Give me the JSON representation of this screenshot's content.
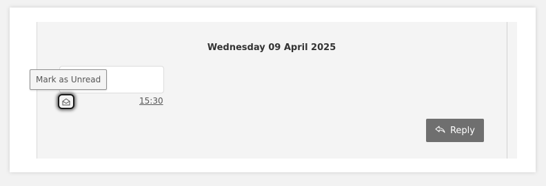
{
  "thread": {
    "date_heading": "Wednesday 09 April 2025",
    "message": {
      "timestamp": "15:30",
      "body": ""
    }
  },
  "tooltip": {
    "text": "Mark as Unread"
  },
  "icons": {
    "mark_unread": "envelope-open-icon",
    "reply": "reply-arrow-icon"
  },
  "actions": {
    "reply_label": "Reply"
  },
  "colors": {
    "reply_button_bg": "#6f6f6f",
    "panel_bg": "#f4f4f4",
    "focus_ring": "#1a1a1a"
  }
}
